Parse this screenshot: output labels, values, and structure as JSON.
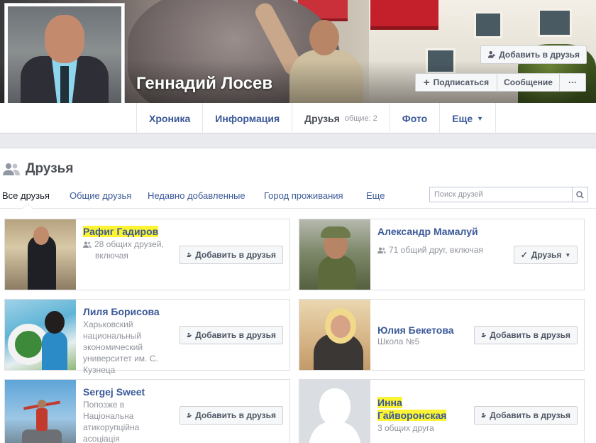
{
  "profile": {
    "name": "Геннадий Лосев",
    "add_friend_label": "Добавить в друзья",
    "subscribe_label": "Подписаться",
    "message_label": "Сообщение",
    "more_label": "···"
  },
  "tabs": [
    {
      "label": "Хроника"
    },
    {
      "label": "Информация"
    },
    {
      "label": "Друзья",
      "sub": "общие: 2"
    },
    {
      "label": "Фото"
    },
    {
      "label": "Еще"
    }
  ],
  "friends": {
    "title": "Друзья",
    "filters": [
      "Все друзья",
      "Общие друзья",
      "Недавно добавленные",
      "Город проживания",
      "Еще"
    ],
    "search_placeholder": "Поиск друзей",
    "cards": [
      {
        "name": "Рафиг Гадиров",
        "meta_line1": "28 общих друзей,",
        "meta_line2": "включая",
        "action": "Добавить в друзья"
      },
      {
        "name": "Александр Мамалуй",
        "meta_line1": "71 общий друг, включая",
        "action": "Друзья"
      },
      {
        "name": "Лиля Борисова",
        "meta_lines": [
          "Харьковский",
          "национальный",
          "экономический",
          "университет им. С.",
          "Кузнеца"
        ],
        "action": "Добавить в друзья"
      },
      {
        "name": "Юлия Бекетова",
        "meta_line1": "Школа №5",
        "action": "Добавить в друзья"
      },
      {
        "name": "Sergej Sweet",
        "meta_lines": [
          "Попозже в",
          "Національна",
          "атикорупційна",
          "асоціація"
        ],
        "action": "Добавить в друзья"
      },
      {
        "name_line1": "Инна",
        "name_line2": "Гайворонская",
        "meta_line1": "3 общих друга",
        "action": "Добавить в друзья"
      }
    ]
  },
  "colors": {
    "link": "#3b5998",
    "highlight": "#fcf332",
    "background": "#e9eaed"
  }
}
